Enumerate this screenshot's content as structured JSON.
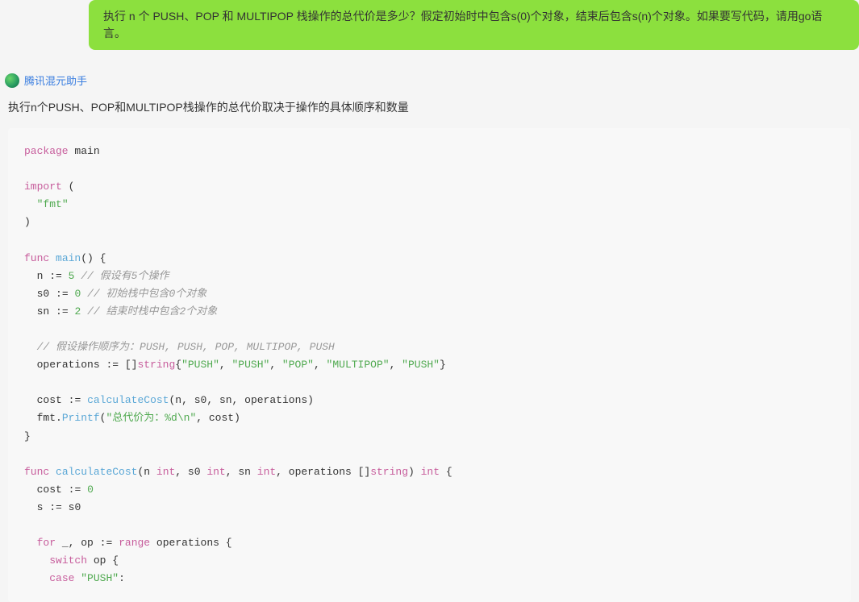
{
  "user_message": "执行 n 个 PUSH、POP 和 MULTIPOP 栈操作的总代价是多少？假定初始时中包含s(0)个对象，结束后包含s(n)个对象。如果要写代码，请用go语言。",
  "assistant": {
    "name": "腾讯混元助手",
    "intro_text": "执行n个PUSH、POP和MULTIPOP栈操作的总代价取决于操作的具体顺序和数量"
  },
  "code": {
    "t_package": "package",
    "t_main": "main",
    "t_import": "import",
    "t_fmt": "\"fmt\"",
    "t_func": "func",
    "t_mainfn": "main",
    "t_n": "n",
    "t_assign": ":=",
    "t_5": "5",
    "t_c1": "// 假设有5个操作",
    "t_s0": "s0",
    "t_0": "0",
    "t_c2": "// 初始栈中包含0个对象",
    "t_sn": "sn",
    "t_2": "2",
    "t_c3": "// 结束时栈中包含2个对象",
    "t_c4": "// 假设操作顺序为：PUSH, PUSH, POP, MULTIPOP, PUSH",
    "t_ops": "operations",
    "t_string": "string",
    "t_push1": "\"PUSH\"",
    "t_push2": "\"PUSH\"",
    "t_pop": "\"POP\"",
    "t_multipop": "\"MULTIPOP\"",
    "t_push3": "\"PUSH\"",
    "t_cost": "cost",
    "t_calcfn": "calculateCost",
    "t_printf": "Printf",
    "t_fmtid": "fmt",
    "t_fmtstr": "\"总代价为：%d\\n\"",
    "t_calcname": "calculateCost",
    "t_int": "int",
    "t_s": "s",
    "t_for": "for",
    "t_range": "range",
    "t_op": "op",
    "t_und": "_",
    "t_switch": "switch",
    "t_case": "case",
    "t_casepush": "\"PUSH\""
  }
}
